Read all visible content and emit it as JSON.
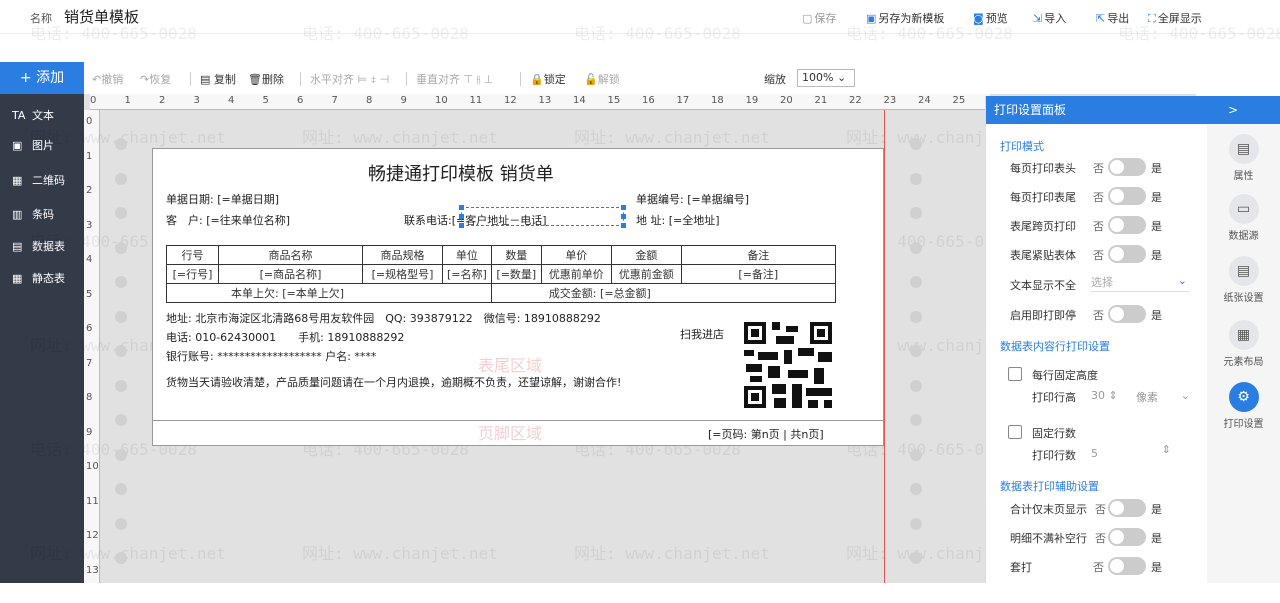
{
  "header": {
    "name_label": "名称",
    "template_name": "销货单模板",
    "actions": [
      {
        "label": "保存"
      },
      {
        "label": "另存为新模板"
      },
      {
        "label": "预览"
      },
      {
        "label": "导入"
      },
      {
        "label": "导出"
      },
      {
        "label": "全屏显示"
      }
    ]
  },
  "add_button": "+ 添加",
  "toolbar": {
    "undo": "撤销",
    "redo": "恢复",
    "copy": "复制",
    "delete": "删除",
    "halign": "水平对齐",
    "valign": "垂直对齐",
    "lock": "锁定",
    "unlock": "解锁",
    "zoom_label": "缩放",
    "zoom_value": "100%"
  },
  "sidebar": {
    "items": [
      {
        "label": "文本",
        "icon": "TA"
      },
      {
        "label": "图片",
        "icon": "▣"
      },
      {
        "label": "二维码",
        "icon": "▦"
      },
      {
        "label": "条码",
        "icon": "▥"
      },
      {
        "label": "数据表",
        "icon": "▤"
      },
      {
        "label": "静态表",
        "icon": "▦"
      }
    ]
  },
  "ruler": {
    "top": [
      "0",
      "1",
      "2",
      "3",
      "4",
      "5",
      "6",
      "7",
      "8",
      "9",
      "10",
      "11",
      "12",
      "13",
      "14",
      "15",
      "16",
      "17",
      "18",
      "19",
      "20",
      "21",
      "22",
      "23",
      "24",
      "25"
    ],
    "left": [
      "0",
      "1",
      "2",
      "3",
      "4",
      "5",
      "6",
      "7",
      "8",
      "9",
      "10",
      "11",
      "12",
      "13"
    ]
  },
  "watermark": {
    "phone": "电话: 400-665-0028",
    "site": "网址: www.chanjet.net"
  },
  "paper": {
    "title": "畅捷通打印模板 销货单",
    "date_label": "单据日期:",
    "date_value": "[=单据日期]",
    "billno_label": "单据编号:",
    "billno_value": "[=单据编号]",
    "customer_label": "客　户:",
    "customer_value": "[=往来单位名称]",
    "phone_label": "联系电话:",
    "phone_value": "[=客户地址－电话]",
    "address_label": "地 址:",
    "address_value": "[=全地址]",
    "table": {
      "headers": [
        "行号",
        "商品名称",
        "商品规格",
        "单位",
        "数量",
        "单价",
        "金额",
        "备注"
      ],
      "row": [
        "[=行号]",
        "[=商品名称]",
        "[=规格型号]",
        "[=名称]",
        "[=数量]",
        "优惠前单价",
        "优惠前金额",
        "[=备注]"
      ],
      "footer_left_label": "本单上欠:",
      "footer_left_value": "[=本单上欠]",
      "footer_right_label": "成交金额:",
      "footer_right_value": "[=总金额]"
    },
    "info_line1": "地址: 北京市海淀区北清路68号用友软件园　QQ: 393879122　微信号: 18910888292",
    "info_line2": "电话: 010-62430001　　手机: 18910888292",
    "info_line3": "银行账号: ******************* 户名: ****",
    "info_line4": "货物当天请验收清楚，产品质量问题请在一个月内退换，逾期概不负责，还望谅解，谢谢合作!",
    "scan_label": "扫我进店",
    "table_region": "表尾区域",
    "footer_region": "页脚区域",
    "page_number": "[=页码: 第n页 | 共n页]"
  },
  "panel": {
    "title": "打印设置面板",
    "collapse": ">",
    "mode_title": "打印模式",
    "rows": [
      {
        "label": "每页打印表头",
        "no": "否",
        "yes": "是"
      },
      {
        "label": "每页打印表尾",
        "no": "否",
        "yes": "是"
      },
      {
        "label": "表尾跨页打印",
        "no": "否",
        "yes": "是"
      },
      {
        "label": "表尾紧贴表体",
        "no": "否",
        "yes": "是"
      }
    ],
    "text_overflow_label": "文本显示不全",
    "text_overflow_value": "选择",
    "instant_label": "启用即打即停",
    "instant_no": "否",
    "instant_yes": "是",
    "data_title": "数据表内容行打印设置",
    "fixed_height_label": "每行固定高度",
    "row_height_label": "打印行高",
    "row_height_value": "30",
    "row_height_unit": "像素",
    "fixed_rows_label": "固定行数",
    "row_count_label": "打印行数",
    "row_count_value": "5",
    "aux_title": "数据表打印辅助设置",
    "aux_rows": [
      {
        "label": "合计仅末页显示",
        "no": "否",
        "yes": "是"
      },
      {
        "label": "明细不满补空行",
        "no": "否",
        "yes": "是"
      },
      {
        "label": "套打",
        "no": "否",
        "yes": "是"
      }
    ]
  },
  "rightbar": [
    {
      "label": "属性",
      "icon": "▤"
    },
    {
      "label": "数据源",
      "icon": "▭"
    },
    {
      "label": "纸张设置",
      "icon": "▤"
    },
    {
      "label": "元素布局",
      "icon": "▦"
    },
    {
      "label": "打印设置",
      "icon": "⚙"
    }
  ]
}
